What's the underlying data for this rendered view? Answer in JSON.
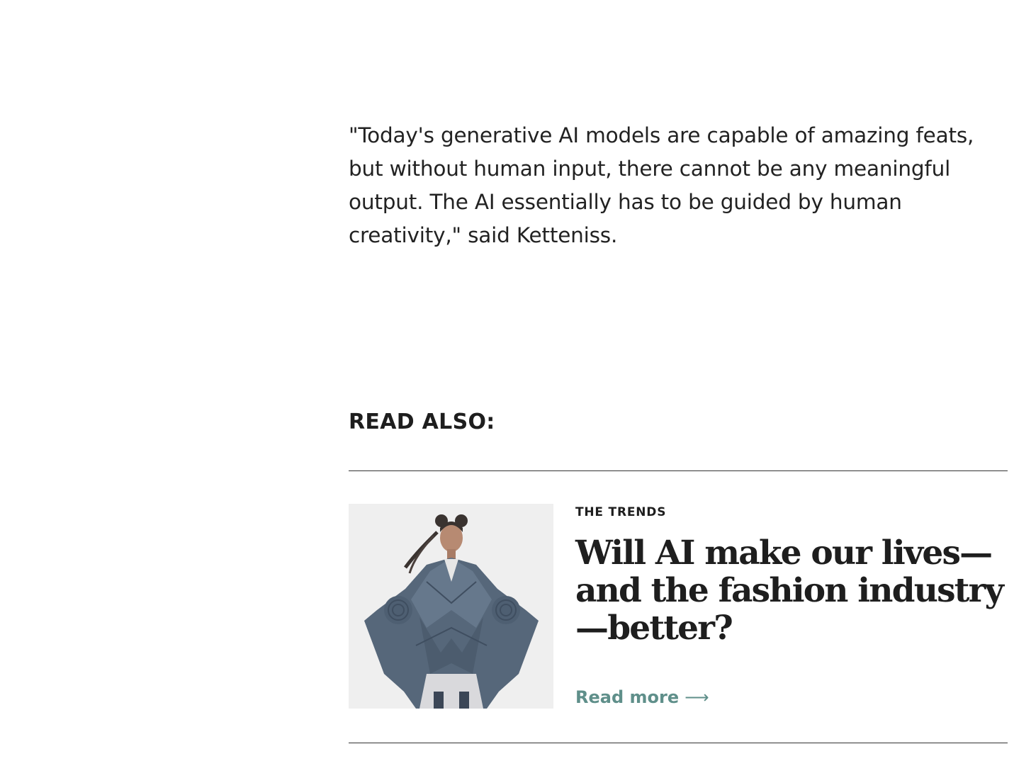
{
  "quote": {
    "text": "\"Today's generative AI models are capable of amazing feats, but without human input, there cannot be any meaningful output. The AI essentially has to be guided by human creativity,\" said Ketteniss."
  },
  "read_also": {
    "heading": "READ ALSO:"
  },
  "article_card": {
    "category": "THE TRENDS",
    "title": "Will AI make our lives—and the fashion industry—better?",
    "read_more_label": "Read more",
    "read_more_arrow": "⟶",
    "image_icon": "fashion-model-photo",
    "accent_color": "#5f8f8a"
  }
}
